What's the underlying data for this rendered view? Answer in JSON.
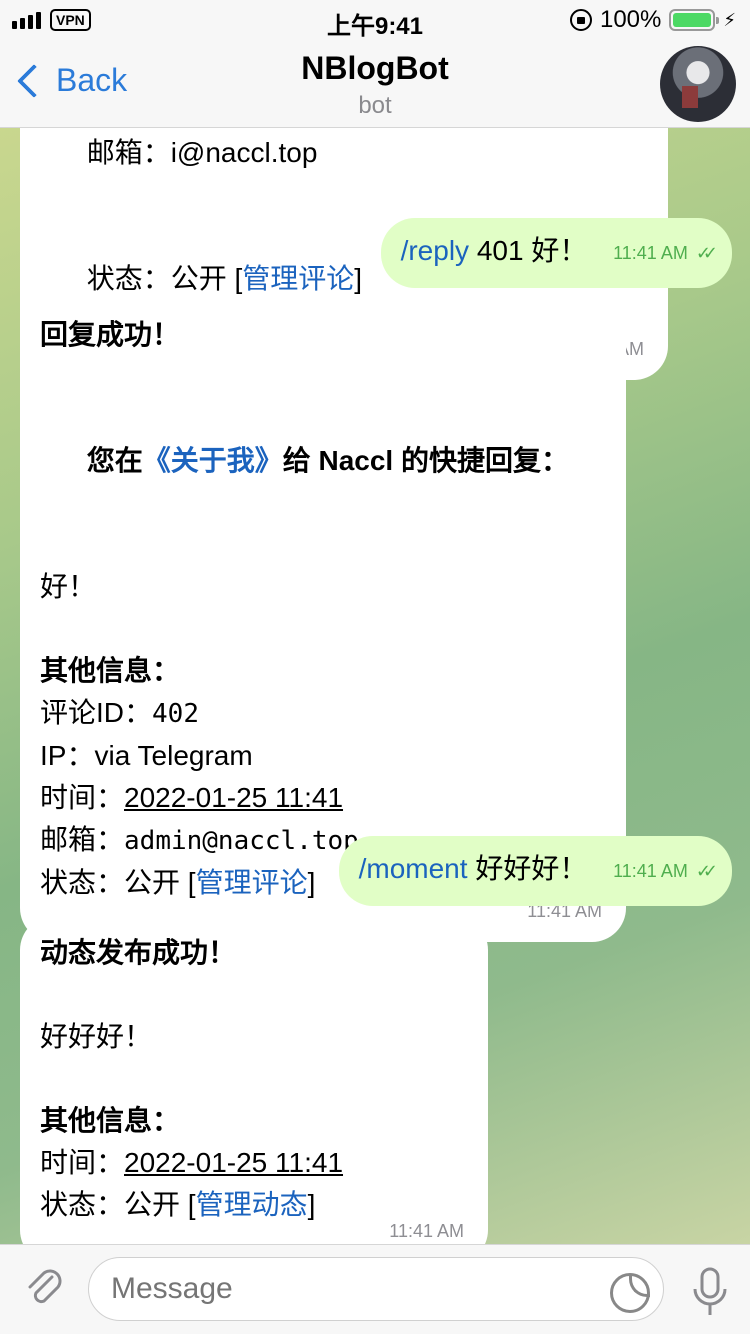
{
  "status_bar": {
    "vpn": "VPN",
    "time": "上午9:41",
    "battery": "100%",
    "battery_color": "#4cd964"
  },
  "nav": {
    "back_label": "Back",
    "title": "NBlogBot",
    "subtitle": "bot"
  },
  "messages": {
    "m1": {
      "lines": [
        "邮箱：i@naccl.top"
      ],
      "status_prefix": "状态：公开 [",
      "status_link": "管理评论",
      "status_suffix": "]",
      "time": "11:40 AM"
    },
    "m2": {
      "command": "/reply",
      "text": " 401 好！",
      "time": "11:41 AM"
    },
    "m3": {
      "title": "回复成功！",
      "intro_prefix": "您在",
      "intro_link": "《关于我》",
      "intro_suffix": "给 Naccl 的快捷回复：",
      "reply": "好！",
      "info_title": "其他信息：",
      "comment_id_label": "评论ID：",
      "comment_id": "402",
      "ip_label": "IP：",
      "ip": "via Telegram",
      "time_label": "时间：",
      "time_value": "2022-01-25 11:41",
      "email_label": "邮箱：",
      "email": "admin@naccl.top",
      "status_prefix": "状态：公开 [",
      "status_link": "管理评论",
      "status_suffix": "]",
      "time": "11:41 AM"
    },
    "m4": {
      "command": "/moment",
      "text": " 好好好！",
      "time": "11:41 AM"
    },
    "m5": {
      "title": "动态发布成功！",
      "content": "好好好！",
      "info_title": "其他信息：",
      "time_label": "时间：",
      "time_value": "2022-01-25 11:41",
      "status_prefix": "状态：公开 [",
      "status_link": "管理动态",
      "status_suffix": "]",
      "time": "11:41 AM"
    }
  },
  "input": {
    "placeholder": "Message"
  },
  "colors": {
    "accent": "#2b7bd9",
    "link": "#1b63be",
    "outgoing_bubble": "#e1fec6",
    "read_tick": "#4fae4e"
  },
  "icons": [
    "signal-icon",
    "lock-rotation-icon",
    "battery-icon",
    "back-chevron-icon",
    "attach-icon",
    "sticker-icon",
    "mic-icon",
    "double-check-icon"
  ]
}
